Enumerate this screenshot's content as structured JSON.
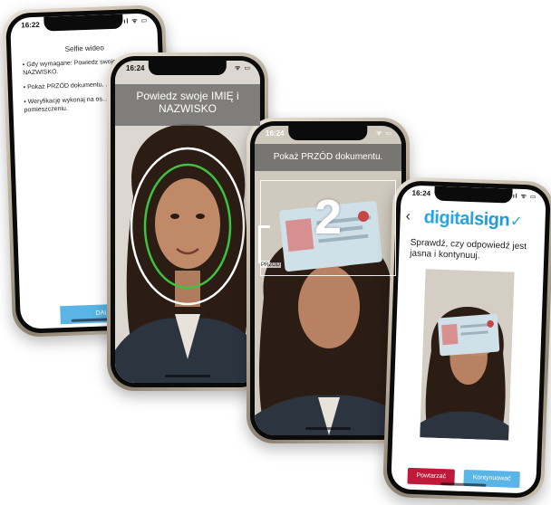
{
  "phone1": {
    "time": "16:22",
    "status_icons": "ıl ᯤ ▭",
    "title": "Selfie wideo",
    "instructions": [
      "• Gdy wymagane: Powiedz swoje IMIĘ i NAZWISKO.",
      "• Pokaż PRZÓD dokumentu, ... dokumentu.",
      "• Weryfikację wykonaj na os... cichym pomieszczeniu."
    ],
    "button": "DALEJ"
  },
  "phone2": {
    "time": "16:24",
    "status_icons": "ᯤ ▭",
    "prompt": "Powiedz swoje IMIĘ i NAZWISKO"
  },
  "phone3": {
    "time": "16:24",
    "status_icons": "ᯤ ▭",
    "prompt": "Pokaż PRZÓD dokumentu.",
    "countdown": "2",
    "doc_label": "PRZOD"
  },
  "phone4": {
    "time": "16:24",
    "status_icons": "ıl ᯤ ▭",
    "back": "‹",
    "logo_a": "digital",
    "logo_b": "sign",
    "logo_check": "✓",
    "message": "Sprawdź, czy odpowiedź jest jasna i kontynuuj.",
    "retry": "Powtarzać",
    "continue": "Kontynuować"
  },
  "colors": {
    "accent": "#5ab4e6",
    "retry": "#c01a3a",
    "oval_green": "#3fc23f",
    "brand": "#2aa5de"
  }
}
